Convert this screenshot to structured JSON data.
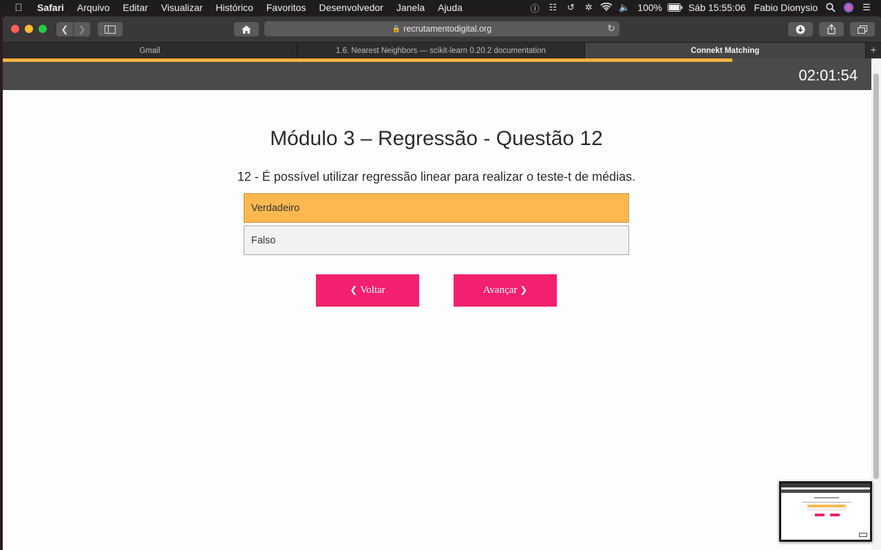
{
  "menubar": {
    "app": "Safari",
    "items": [
      "Arquivo",
      "Editar",
      "Visualizar",
      "Histórico",
      "Favoritos",
      "Desenvolvedor",
      "Janela",
      "Ajuda"
    ],
    "battery": "100%",
    "clock": "Sáb 15:55:06",
    "user": "Fabio Dionysio"
  },
  "browser": {
    "url": "recrutamentodigital.org",
    "tabs": [
      {
        "label": "Gmail"
      },
      {
        "label": "1.6. Nearest Neighbors — scikit-learn 0.20.2 documentation"
      },
      {
        "label": "Connekt Matching"
      }
    ],
    "new_tab": "+"
  },
  "page": {
    "timer": "02:01:54",
    "progress_percent": 84,
    "title": "Módulo 3 – Regressão - Questão 12",
    "question": "12 - É possível utilizar regressão linear para realizar o teste-t de médias.",
    "options": [
      {
        "label": "Verdadeiro",
        "selected": true
      },
      {
        "label": "Falso",
        "selected": false
      }
    ],
    "back_label": "Voltar",
    "next_label": "Avançar"
  },
  "colors": {
    "accent": "#f2206e",
    "selected_option": "#fdb94f",
    "progress": "#fbb040"
  }
}
